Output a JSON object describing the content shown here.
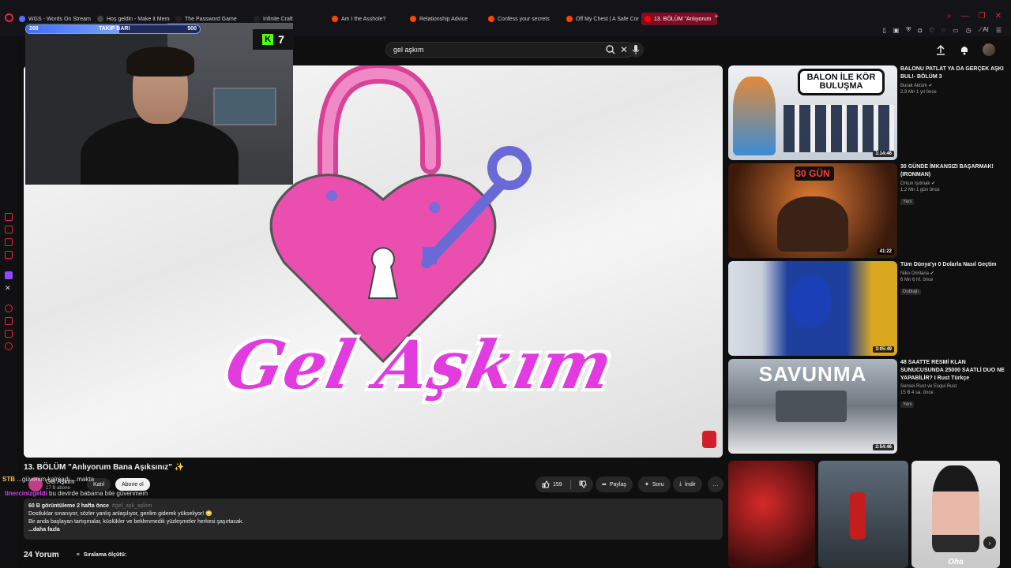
{
  "browser": {
    "tabs": [
      {
        "label": "WGS - Words On Stream",
        "fav": "#5b6cff"
      },
      {
        "label": "Hoş geldin - Make it Meme",
        "fav": "#444"
      },
      {
        "label": "The Password Game",
        "fav": "#222"
      },
      {
        "label": "Infinite Craft",
        "fav": "#222"
      },
      {
        "label": "Am I the Asshole?",
        "fav": "#ff4500"
      },
      {
        "label": "Relationship Advice",
        "fav": "#ff4500"
      },
      {
        "label": "Confess your secrets",
        "fav": "#ff4500"
      },
      {
        "label": "Off My Chest | A Safe Comr",
        "fav": "#ff4500"
      },
      {
        "label": "13. BÖLÜM \"Anlıyorum",
        "fav": "#ff0000"
      }
    ],
    "active_tab_index": 8,
    "extension_label": "AI"
  },
  "youtube": {
    "search_value": "gel aşkım",
    "video": {
      "thumb_title": "Gel Aşkım",
      "title": "13. BÖLÜM \"Anlıyorum Bana Aşıksınız\" ✨",
      "channel": "Gel Aşkım",
      "subscribers": "17 B abone",
      "join_label": "Katıl",
      "subscribe_label": "Abone ol",
      "likes": "159",
      "share_label": "Paylaş",
      "ask_label": "Soru",
      "download_label": "İndir",
      "more_label": "…"
    },
    "description": {
      "stats": "60 B görüntüleme  2 hafta önce",
      "tags": "#gel_aşk_aşkım",
      "line1": "Dostluklar sınanıyor, sözler yanlış anlaşılıyor, gerilim giderek yükseliyor! 😳",
      "line2": "Bir anda başlayan tartışmalar, küslükler ve beklenmedik yüzleşmeler herkesi şaşırtacak.",
      "more": "...daha fazla"
    },
    "comments": {
      "count_label": "24 Yorum",
      "sort_label": "Sıralama ölçütü:"
    },
    "recommendations": [
      {
        "title": "BALONU PATLAT YA DA GERÇEK AŞKI BUL!- BÖLÜM 3",
        "channel": "Burak Aktürk ✔",
        "meta": "2,9 Mn  1 yıl önce",
        "duration": "1:14:46",
        "badge": "",
        "thumb_text": "BALON İLE KÖR BULUŞMA",
        "colors": [
          "#dfe3e8",
          "#b8c2cc"
        ]
      },
      {
        "title": "30 GÜNDE İMKANSIZI BAŞARMAK! (IRONMAN)",
        "channel": "Orkun Işıtmak ✔",
        "meta": "1,2 Mn  1 gün önce",
        "duration": "41:22",
        "badge": "Yeni",
        "thumb_text": "30 GÜN",
        "colors": [
          "#d6632a",
          "#3a1a0e"
        ]
      },
      {
        "title": "Tüm Dünya'yı 0 Dolarla Nasıl Geçtim",
        "channel": "Niko Omilana ✔",
        "meta": "6 Mn  6 hf. önce",
        "duration": "3:05:49",
        "badge": "Dublajlı",
        "thumb_text": "",
        "colors": [
          "#2a4fb0",
          "#0e1a3e"
        ]
      },
      {
        "title": "48 SAATTE RESMİ KLAN SUNUCUSUNDA 25000 SAATLİ DUO NE YAPABİLİR? I Rust Türkçe",
        "channel": "Sensei Rust ve Esqui Rust",
        "meta": "15 B  4 sa. önce",
        "duration": "2:54:46",
        "badge": "Yeni",
        "thumb_text": "SAVUNMA",
        "colors": [
          "#9aa6b0",
          "#3a4048"
        ]
      }
    ],
    "shorts_caption": "Oha"
  },
  "stream_overlay": {
    "goal_current": "268",
    "goal_label": "TAKİP BARI",
    "goal_target": "500",
    "goal_progress": 0.536,
    "kick_viewers": "7",
    "chat": [
      {
        "user": "STB",
        "text": "...güvenim kalmadı ...makta"
      },
      {
        "user": "tinercinizgeldi",
        "text": "bu devirde babama bile güvenmem"
      }
    ]
  }
}
